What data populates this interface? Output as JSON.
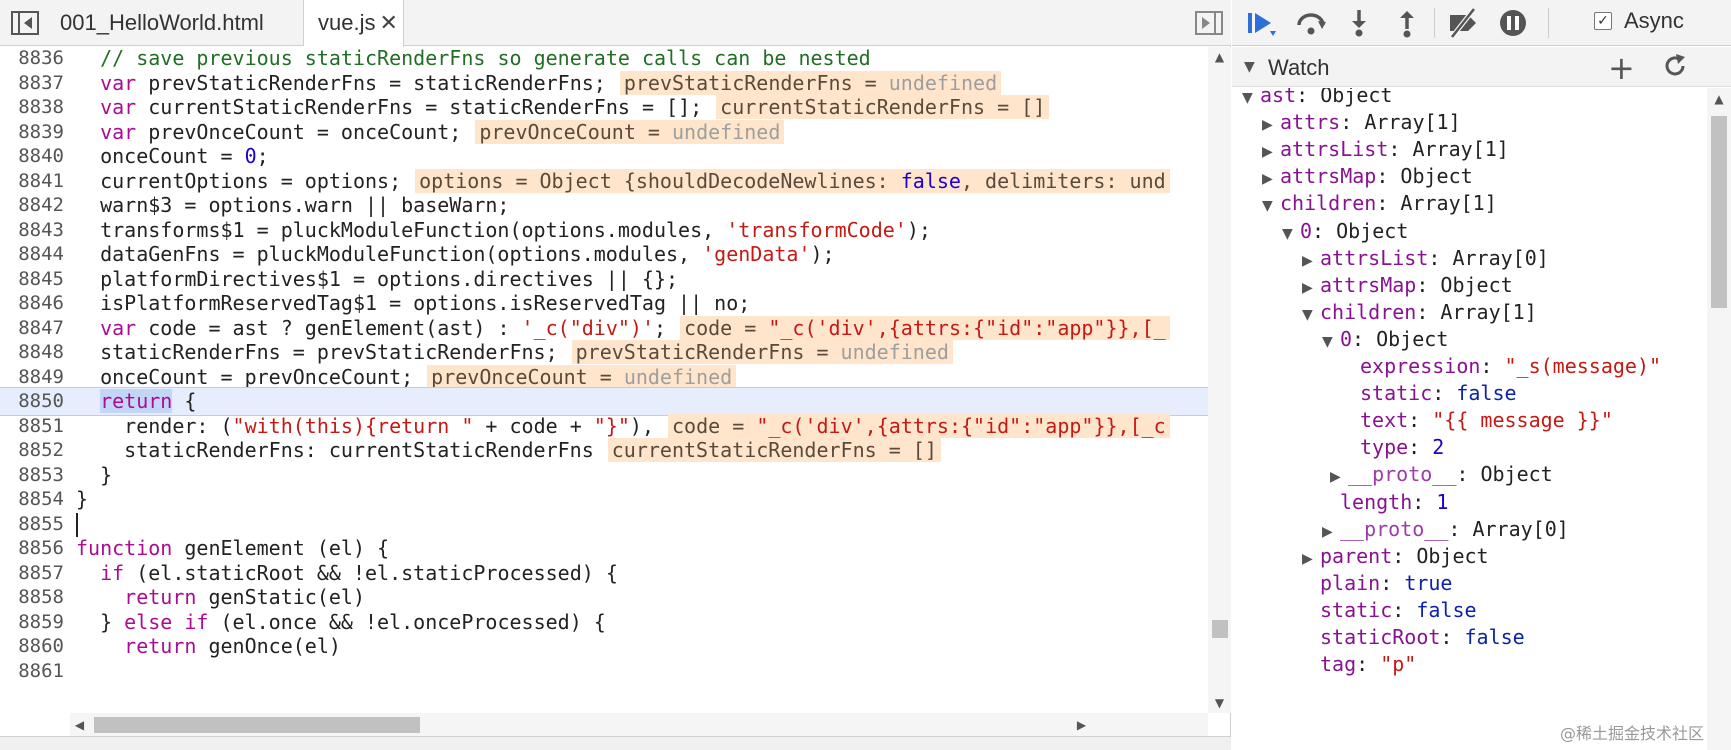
{
  "tabs": [
    {
      "label": "001_HelloWorld.html"
    },
    {
      "label": "vue.js",
      "close": "✕"
    }
  ],
  "code_lines": [
    {
      "num": "8836",
      "segs": [
        {
          "t": "  ",
          "c": "plain"
        },
        {
          "t": "// save previous staticRenderFns so generate calls can be nested",
          "c": "cmt"
        }
      ]
    },
    {
      "num": "8837",
      "segs": [
        {
          "t": "  ",
          "c": "plain"
        },
        {
          "t": "var",
          "c": "kw"
        },
        {
          "t": " prevStaticRenderFns = staticRenderFns;",
          "c": "plain"
        }
      ],
      "inline": [
        {
          "t": "prevStaticRenderFns = ",
          "c": ""
        },
        {
          "t": "undefined",
          "c": "und"
        }
      ]
    },
    {
      "num": "8838",
      "segs": [
        {
          "t": "  ",
          "c": "plain"
        },
        {
          "t": "var",
          "c": "kw"
        },
        {
          "t": " currentStaticRenderFns = staticRenderFns = [];",
          "c": "plain"
        }
      ],
      "inline": [
        {
          "t": "currentStaticRenderFns = []",
          "c": ""
        }
      ]
    },
    {
      "num": "8839",
      "segs": [
        {
          "t": "  ",
          "c": "plain"
        },
        {
          "t": "var",
          "c": "kw"
        },
        {
          "t": " prevOnceCount = onceCount;",
          "c": "plain"
        }
      ],
      "inline": [
        {
          "t": "prevOnceCount = ",
          "c": ""
        },
        {
          "t": "undefined",
          "c": "und"
        }
      ]
    },
    {
      "num": "8840",
      "segs": [
        {
          "t": "  onceCount = ",
          "c": "plain"
        },
        {
          "t": "0",
          "c": "num"
        },
        {
          "t": ";",
          "c": "plain"
        }
      ]
    },
    {
      "num": "8841",
      "segs": [
        {
          "t": "  currentOptions = options;",
          "c": "plain"
        }
      ],
      "inline": [
        {
          "t": "options = Object {shouldDecodeNewlines: ",
          "c": ""
        },
        {
          "t": "false",
          "c": "b"
        },
        {
          "t": ", delimiters: und",
          "c": ""
        }
      ]
    },
    {
      "num": "8842",
      "segs": [
        {
          "t": "  warn$3 = options.warn || baseWarn;",
          "c": "plain"
        }
      ]
    },
    {
      "num": "8843",
      "segs": [
        {
          "t": "  transforms$1 = pluckModuleFunction(options.modules, ",
          "c": "plain"
        },
        {
          "t": "'transformCode'",
          "c": "str"
        },
        {
          "t": ");",
          "c": "plain"
        }
      ]
    },
    {
      "num": "8844",
      "segs": [
        {
          "t": "  dataGenFns = pluckModuleFunction(options.modules, ",
          "c": "plain"
        },
        {
          "t": "'genData'",
          "c": "str"
        },
        {
          "t": ");",
          "c": "plain"
        }
      ]
    },
    {
      "num": "8845",
      "segs": [
        {
          "t": "  platformDirectives$1 = options.directives || {};",
          "c": "plain"
        }
      ]
    },
    {
      "num": "8846",
      "segs": [
        {
          "t": "  isPlatformReservedTag$1 = options.isReservedTag || no;",
          "c": "plain"
        }
      ]
    },
    {
      "num": "8847",
      "segs": [
        {
          "t": "  ",
          "c": "plain"
        },
        {
          "t": "var",
          "c": "kw"
        },
        {
          "t": " code = ast ? genElement(ast) : ",
          "c": "plain"
        },
        {
          "t": "'_c(\"div\")'",
          "c": "str"
        },
        {
          "t": ";",
          "c": "plain"
        }
      ],
      "inline": [
        {
          "t": "code = ",
          "c": ""
        },
        {
          "t": "\"_c('div',{attrs:{\"id\":\"app\"}},[_",
          "c": "s"
        }
      ]
    },
    {
      "num": "8848",
      "segs": [
        {
          "t": "  staticRenderFns = prevStaticRenderFns;",
          "c": "plain"
        }
      ],
      "inline": [
        {
          "t": "prevStaticRenderFns = ",
          "c": ""
        },
        {
          "t": "undefined",
          "c": "und"
        }
      ]
    },
    {
      "num": "8849",
      "segs": [
        {
          "t": "  onceCount = prevOnceCount;",
          "c": "plain"
        }
      ],
      "inline": [
        {
          "t": "prevOnceCount = ",
          "c": ""
        },
        {
          "t": "undefined",
          "c": "und"
        }
      ]
    },
    {
      "num": "8850",
      "current": true,
      "segs": [
        {
          "t": "  ",
          "c": "plain"
        },
        {
          "t": "return",
          "c": "kw sel"
        },
        {
          "t": " {",
          "c": "plain"
        }
      ]
    },
    {
      "num": "8851",
      "segs": [
        {
          "t": "    render: (",
          "c": "plain"
        },
        {
          "t": "\"with(this){return \"",
          "c": "str"
        },
        {
          "t": " + code + ",
          "c": "plain"
        },
        {
          "t": "\"}\"",
          "c": "str"
        },
        {
          "t": "),",
          "c": "plain"
        }
      ],
      "inline": [
        {
          "t": "code = ",
          "c": ""
        },
        {
          "t": "\"_c('div',{attrs:{\"id\":\"app\"}},[_c",
          "c": "s"
        }
      ]
    },
    {
      "num": "8852",
      "segs": [
        {
          "t": "    staticRenderFns: currentStaticRenderFns",
          "c": "plain"
        }
      ],
      "inline": [
        {
          "t": "currentStaticRenderFns = []",
          "c": ""
        }
      ]
    },
    {
      "num": "8853",
      "segs": [
        {
          "t": "  }",
          "c": "plain"
        }
      ]
    },
    {
      "num": "8854",
      "segs": [
        {
          "t": "}",
          "c": "plain"
        }
      ]
    },
    {
      "num": "8855",
      "caret": true,
      "segs": []
    },
    {
      "num": "8856",
      "segs": [
        {
          "t": "function",
          "c": "kw"
        },
        {
          "t": " genElement (el) {",
          "c": "plain"
        }
      ]
    },
    {
      "num": "8857",
      "segs": [
        {
          "t": "  ",
          "c": "plain"
        },
        {
          "t": "if",
          "c": "kw"
        },
        {
          "t": " (el.staticRoot && !el.staticProcessed) {",
          "c": "plain"
        }
      ]
    },
    {
      "num": "8858",
      "segs": [
        {
          "t": "    ",
          "c": "plain"
        },
        {
          "t": "return",
          "c": "kw"
        },
        {
          "t": " genStatic(el)",
          "c": "plain"
        }
      ]
    },
    {
      "num": "8859",
      "segs": [
        {
          "t": "  } ",
          "c": "plain"
        },
        {
          "t": "else if",
          "c": "kw"
        },
        {
          "t": " (el.once && !el.onceProcessed) {",
          "c": "plain"
        }
      ]
    },
    {
      "num": "8860",
      "segs": [
        {
          "t": "    ",
          "c": "plain"
        },
        {
          "t": "return",
          "c": "kw"
        },
        {
          "t": " genOnce(el)",
          "c": "plain"
        }
      ]
    },
    {
      "num": "8861",
      "segs": []
    }
  ],
  "debugger": {
    "async_label": "Async",
    "async_checked": "✓",
    "watch_title": "Watch",
    "watch_add": "+"
  },
  "tree": [
    {
      "depth": 0,
      "tri": "▼",
      "key": "ast",
      "val": "Object",
      "vt": "obj"
    },
    {
      "depth": 1,
      "tri": "▶",
      "key": "attrs",
      "val": "Array[1]",
      "vt": "obj"
    },
    {
      "depth": 1,
      "tri": "▶",
      "key": "attrsList",
      "val": "Array[1]",
      "vt": "obj"
    },
    {
      "depth": 1,
      "tri": "▶",
      "key": "attrsMap",
      "val": "Object",
      "vt": "obj"
    },
    {
      "depth": 1,
      "tri": "▼",
      "key": "children",
      "val": "Array[1]",
      "vt": "obj"
    },
    {
      "depth": 2,
      "tri": "▼",
      "key": "0",
      "val": "Object",
      "vt": "obj"
    },
    {
      "depth": 3,
      "tri": "▶",
      "key": "attrsList",
      "val": "Array[0]",
      "vt": "obj"
    },
    {
      "depth": 3,
      "tri": "▶",
      "key": "attrsMap",
      "val": "Object",
      "vt": "obj"
    },
    {
      "depth": 3,
      "tri": "▼",
      "key": "children",
      "val": "Array[1]",
      "vt": "obj"
    },
    {
      "depth": 4,
      "tri": "▼",
      "key": "0",
      "val": "Object",
      "vt": "obj"
    },
    {
      "depth": 5,
      "tri": "",
      "key": "expression",
      "val": "\"_s(message)\"",
      "vt": "str"
    },
    {
      "depth": 5,
      "tri": "",
      "key": "static",
      "val": "false",
      "vt": "bool"
    },
    {
      "depth": 5,
      "tri": "",
      "key": "text",
      "val": "\"{{ message }}\"",
      "vt": "str"
    },
    {
      "depth": 5,
      "tri": "",
      "key": "type",
      "val": "2",
      "vt": "num"
    },
    {
      "depth": 5,
      "tri": "▶",
      "key": "__proto__",
      "val": "Object",
      "vt": "obj",
      "proto": true,
      "tri_offset": true
    },
    {
      "depth": 4,
      "tri": "",
      "key": "length",
      "val": "1",
      "vt": "num",
      "pad": true
    },
    {
      "depth": 4,
      "tri": "▶",
      "key": "__proto__",
      "val": "Array[0]",
      "vt": "obj",
      "proto": true
    },
    {
      "depth": 3,
      "tri": "▶",
      "key": "parent",
      "val": "Object",
      "vt": "obj"
    },
    {
      "depth": 3,
      "tri": "",
      "key": "plain",
      "val": "true",
      "vt": "bool",
      "pad": true
    },
    {
      "depth": 3,
      "tri": "",
      "key": "static",
      "val": "false",
      "vt": "bool",
      "pad": true
    },
    {
      "depth": 3,
      "tri": "",
      "key": "staticRoot",
      "val": "false",
      "vt": "bool",
      "pad": true
    },
    {
      "depth": 3,
      "tri": "",
      "key": "tag",
      "val": "\"p\"",
      "vt": "str",
      "pad": true
    }
  ],
  "watermark": "@稀土掘金技术社区"
}
